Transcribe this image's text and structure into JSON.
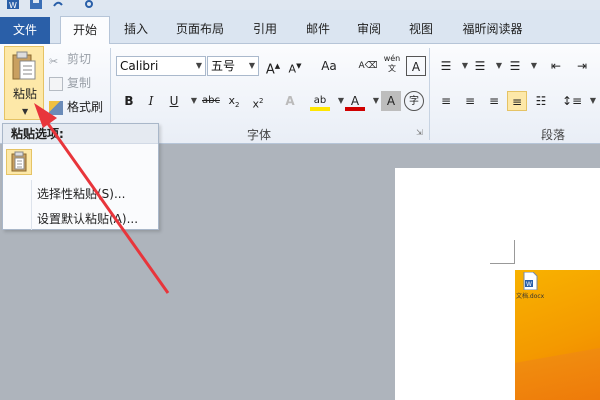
{
  "tabs": {
    "file": "文件",
    "home": "开始",
    "insert": "插入",
    "page_layout": "页面布局",
    "references": "引用",
    "mailings": "邮件",
    "review": "审阅",
    "view": "视图",
    "foxit_reader": "福昕阅读器"
  },
  "clipboard": {
    "paste_label": "粘贴",
    "cut_label": "剪切",
    "copy_label": "复制",
    "format_painter_label": "格式刷"
  },
  "font": {
    "group_label": "字体",
    "font_name": "Calibri",
    "font_size": "五号",
    "case_button": "Aa",
    "wen_label": "wén"
  },
  "paragraph": {
    "group_label": "段落"
  },
  "paste_menu": {
    "header": "粘贴选项:",
    "paste_special": "选择性粘贴(S)...",
    "set_default_paste": "设置默认粘贴(A)..."
  },
  "document": {
    "file_icon_label": "文档.docx"
  },
  "colors": {
    "file_tab": "#2a5fa8",
    "highlight": "#fde8a8",
    "annotation_arrow": "#e8353b",
    "orange": "#f8b200"
  }
}
